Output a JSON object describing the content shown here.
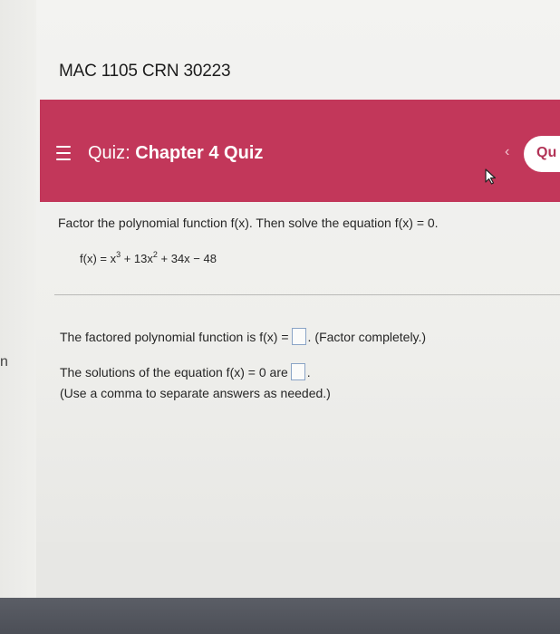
{
  "course": {
    "title": "MAC 1105 CRN 30223"
  },
  "header": {
    "quiz_prefix": "Quiz: ",
    "quiz_name": "Chapter 4 Quiz",
    "back_glyph": "‹",
    "side_tab_label": "Qu",
    "accent_color": "#c2375a"
  },
  "left_fragment": "n",
  "question": {
    "prompt": "Factor the polynomial function f(x). Then solve the equation f(x) = 0.",
    "eq_prefix": "f(x) = x",
    "eq_exp1": "3",
    "eq_mid": " + 13x",
    "eq_exp2": "2",
    "eq_suffix": " + 34x − 48"
  },
  "answers": {
    "line1_prefix": "The factored polynomial function is f(x) =",
    "line1_punct": ".",
    "line1_hint": "(Factor completely.)",
    "line2_prefix": "The solutions of the equation f(x) = 0 are",
    "line2_punct": ".",
    "line2_hint": "(Use a comma to separate answers as needed.)"
  }
}
